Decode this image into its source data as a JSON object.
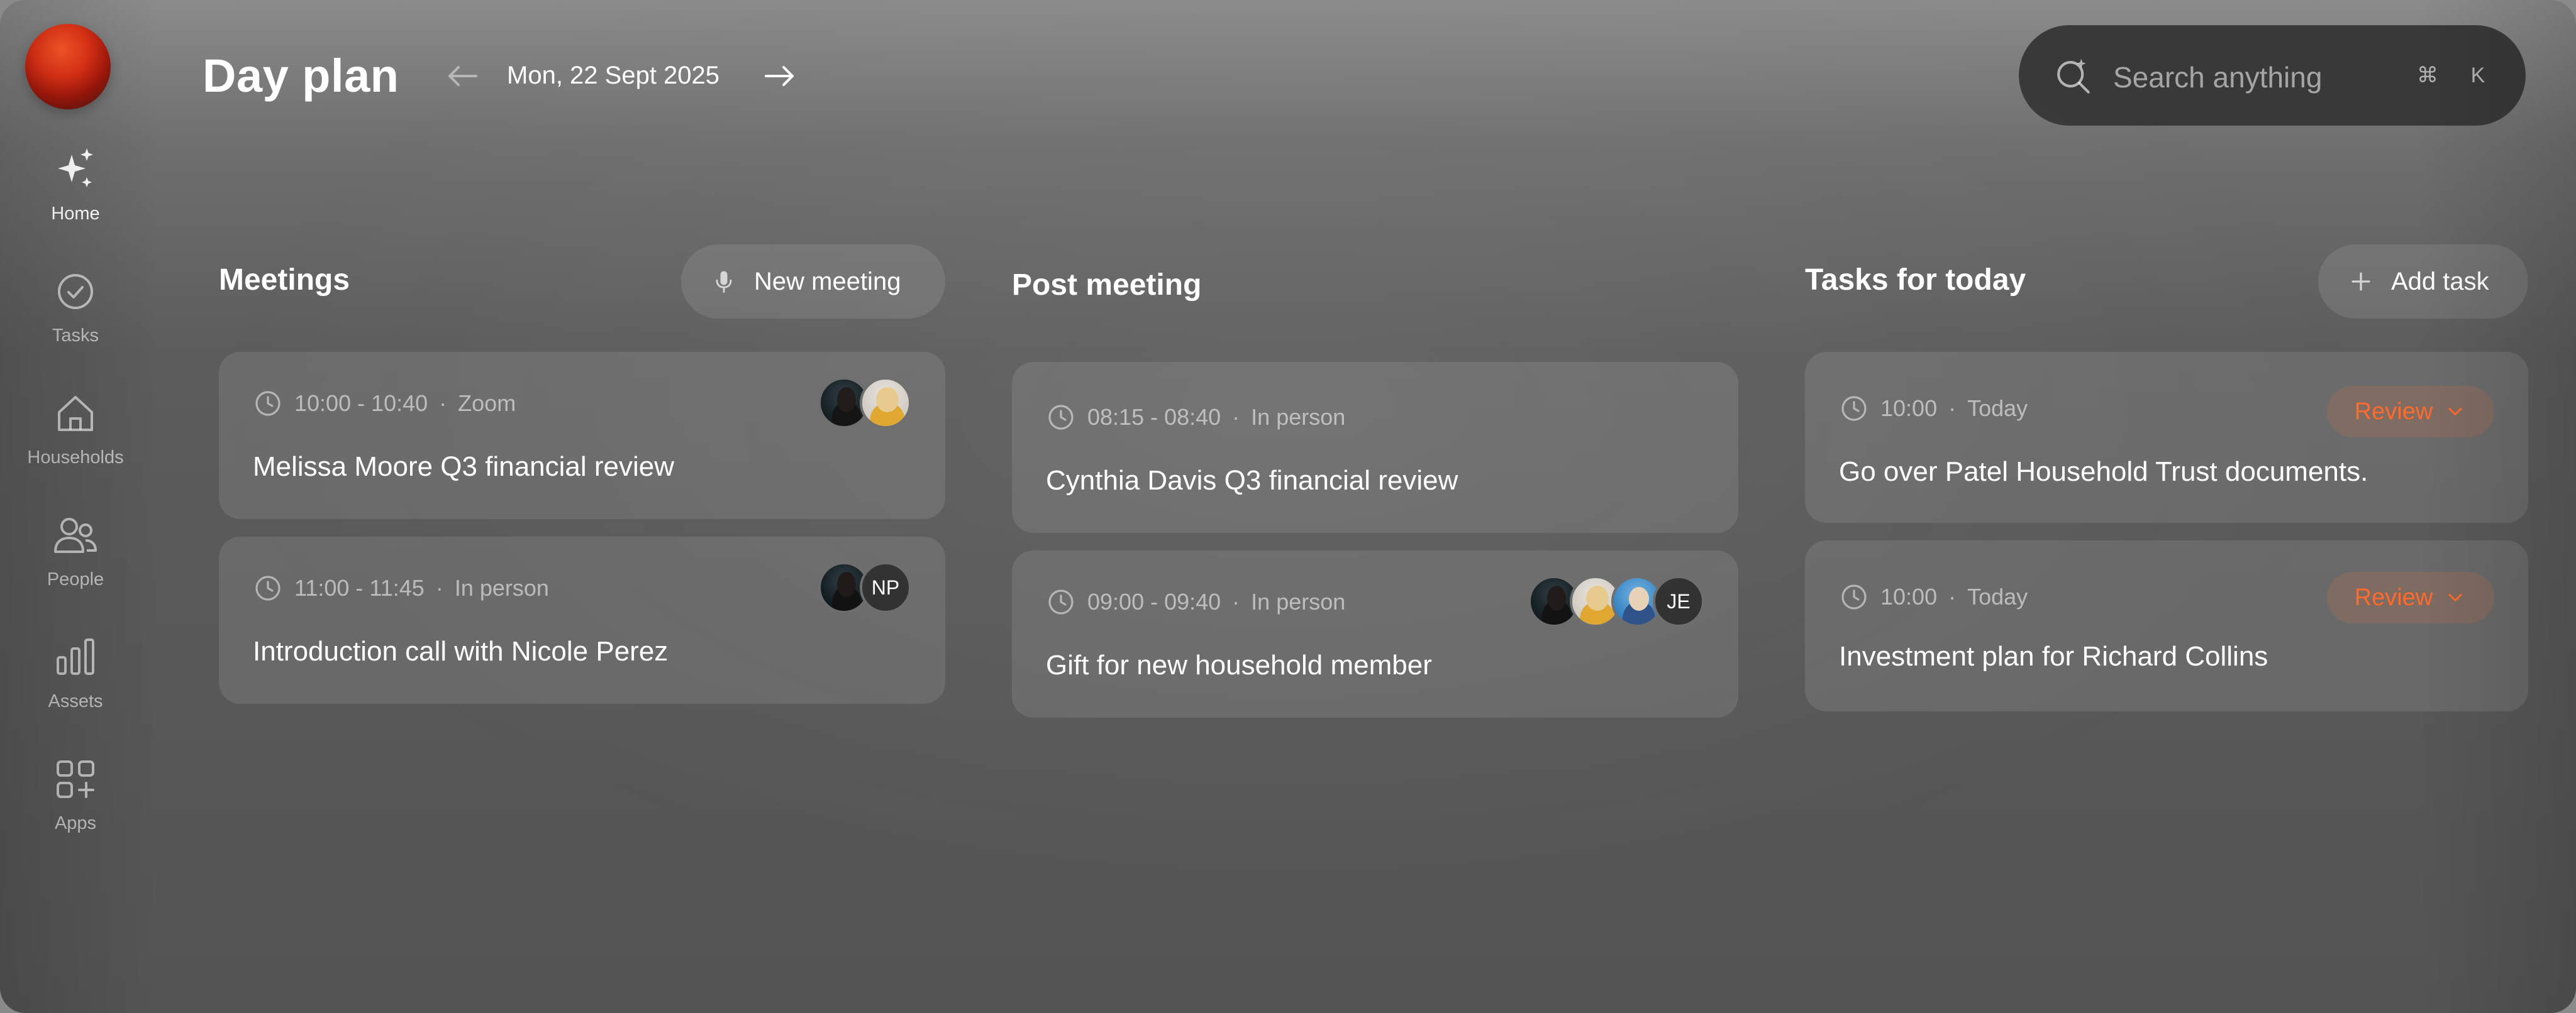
{
  "sidebar": {
    "items": [
      {
        "label": "Home",
        "icon": "sparkles-icon",
        "active": true
      },
      {
        "label": "Tasks",
        "icon": "check-circle-icon"
      },
      {
        "label": "Households",
        "icon": "house-icon"
      },
      {
        "label": "People",
        "icon": "people-icon"
      },
      {
        "label": "Assets",
        "icon": "bar-chart-icon"
      },
      {
        "label": "Apps",
        "icon": "apps-grid-icon"
      }
    ]
  },
  "header": {
    "title": "Day plan",
    "date": "Mon, 22 Sept 2025"
  },
  "search": {
    "placeholder": "Search anything",
    "shortcut_cmd": "⌘",
    "shortcut_key": "K"
  },
  "meetings": {
    "title": "Meetings",
    "new_button": "New meeting",
    "items": [
      {
        "time": "10:00 - 10:40",
        "location": "Zoom",
        "title": "Melissa Moore Q3 financial review"
      },
      {
        "time": "11:00 - 11:45",
        "location": "In person",
        "title": "Introduction call with Nicole Perez",
        "initials": "NP"
      }
    ]
  },
  "post_meeting": {
    "title": "Post meeting",
    "items": [
      {
        "time": "08:15 - 08:40",
        "location": "In person",
        "title": "Cynthia Davis Q3 financial review"
      },
      {
        "time": "09:00 - 09:40",
        "location": "In person",
        "title": "Gift for new household member",
        "initials": "JE"
      }
    ]
  },
  "tasks": {
    "title": "Tasks for today",
    "add_button": "Add task",
    "items": [
      {
        "time": "10:00",
        "day": "Today",
        "title": "Go over Patel Household Trust documents.",
        "action": "Review"
      },
      {
        "time": "10:00",
        "day": "Today",
        "title": "Investment plan for Richard Collins",
        "action": "Review"
      }
    ]
  },
  "colors": {
    "accent": "#ff6b2c",
    "logo": "#e23316"
  },
  "separator": "·"
}
